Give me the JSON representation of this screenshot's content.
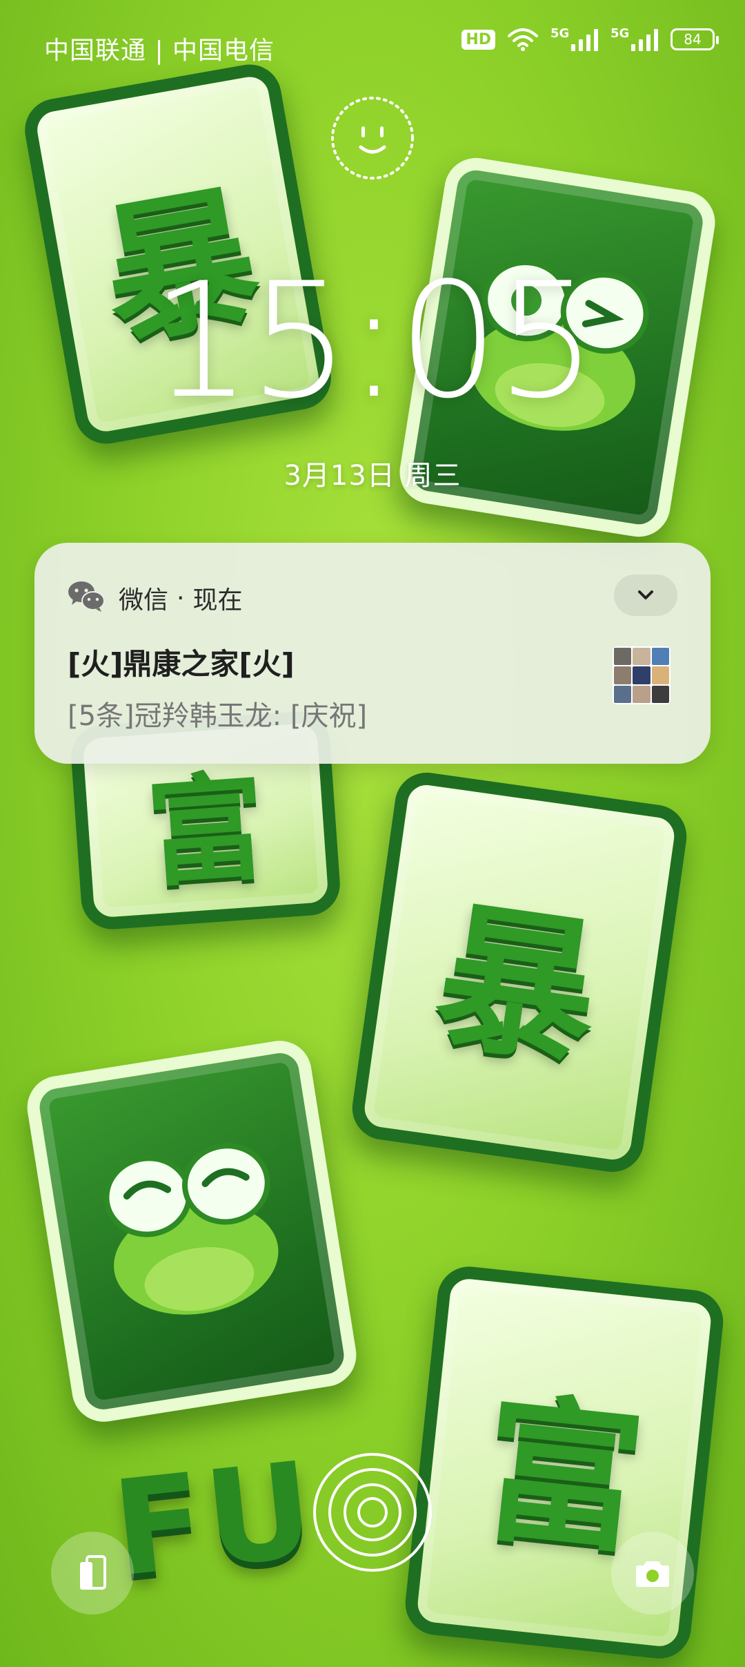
{
  "status_bar": {
    "carrier": "中国联通 | 中国电信",
    "hd_label": "HD",
    "network_1": "5G",
    "network_2": "5G",
    "battery": "84"
  },
  "lockscreen": {
    "time": "15:05",
    "date": "3月13日 周三"
  },
  "notification": {
    "app_name": "微信",
    "separator": "·",
    "time_ago": "现在",
    "title": "[火]鼎康之家[火]",
    "body": "[5条]冠羚韩玉龙: [庆祝]"
  },
  "wallpaper": {
    "glyph_bao": "暴",
    "glyph_fu": "富",
    "fu_text": "FU",
    "accent_green": "#8fd22a"
  }
}
